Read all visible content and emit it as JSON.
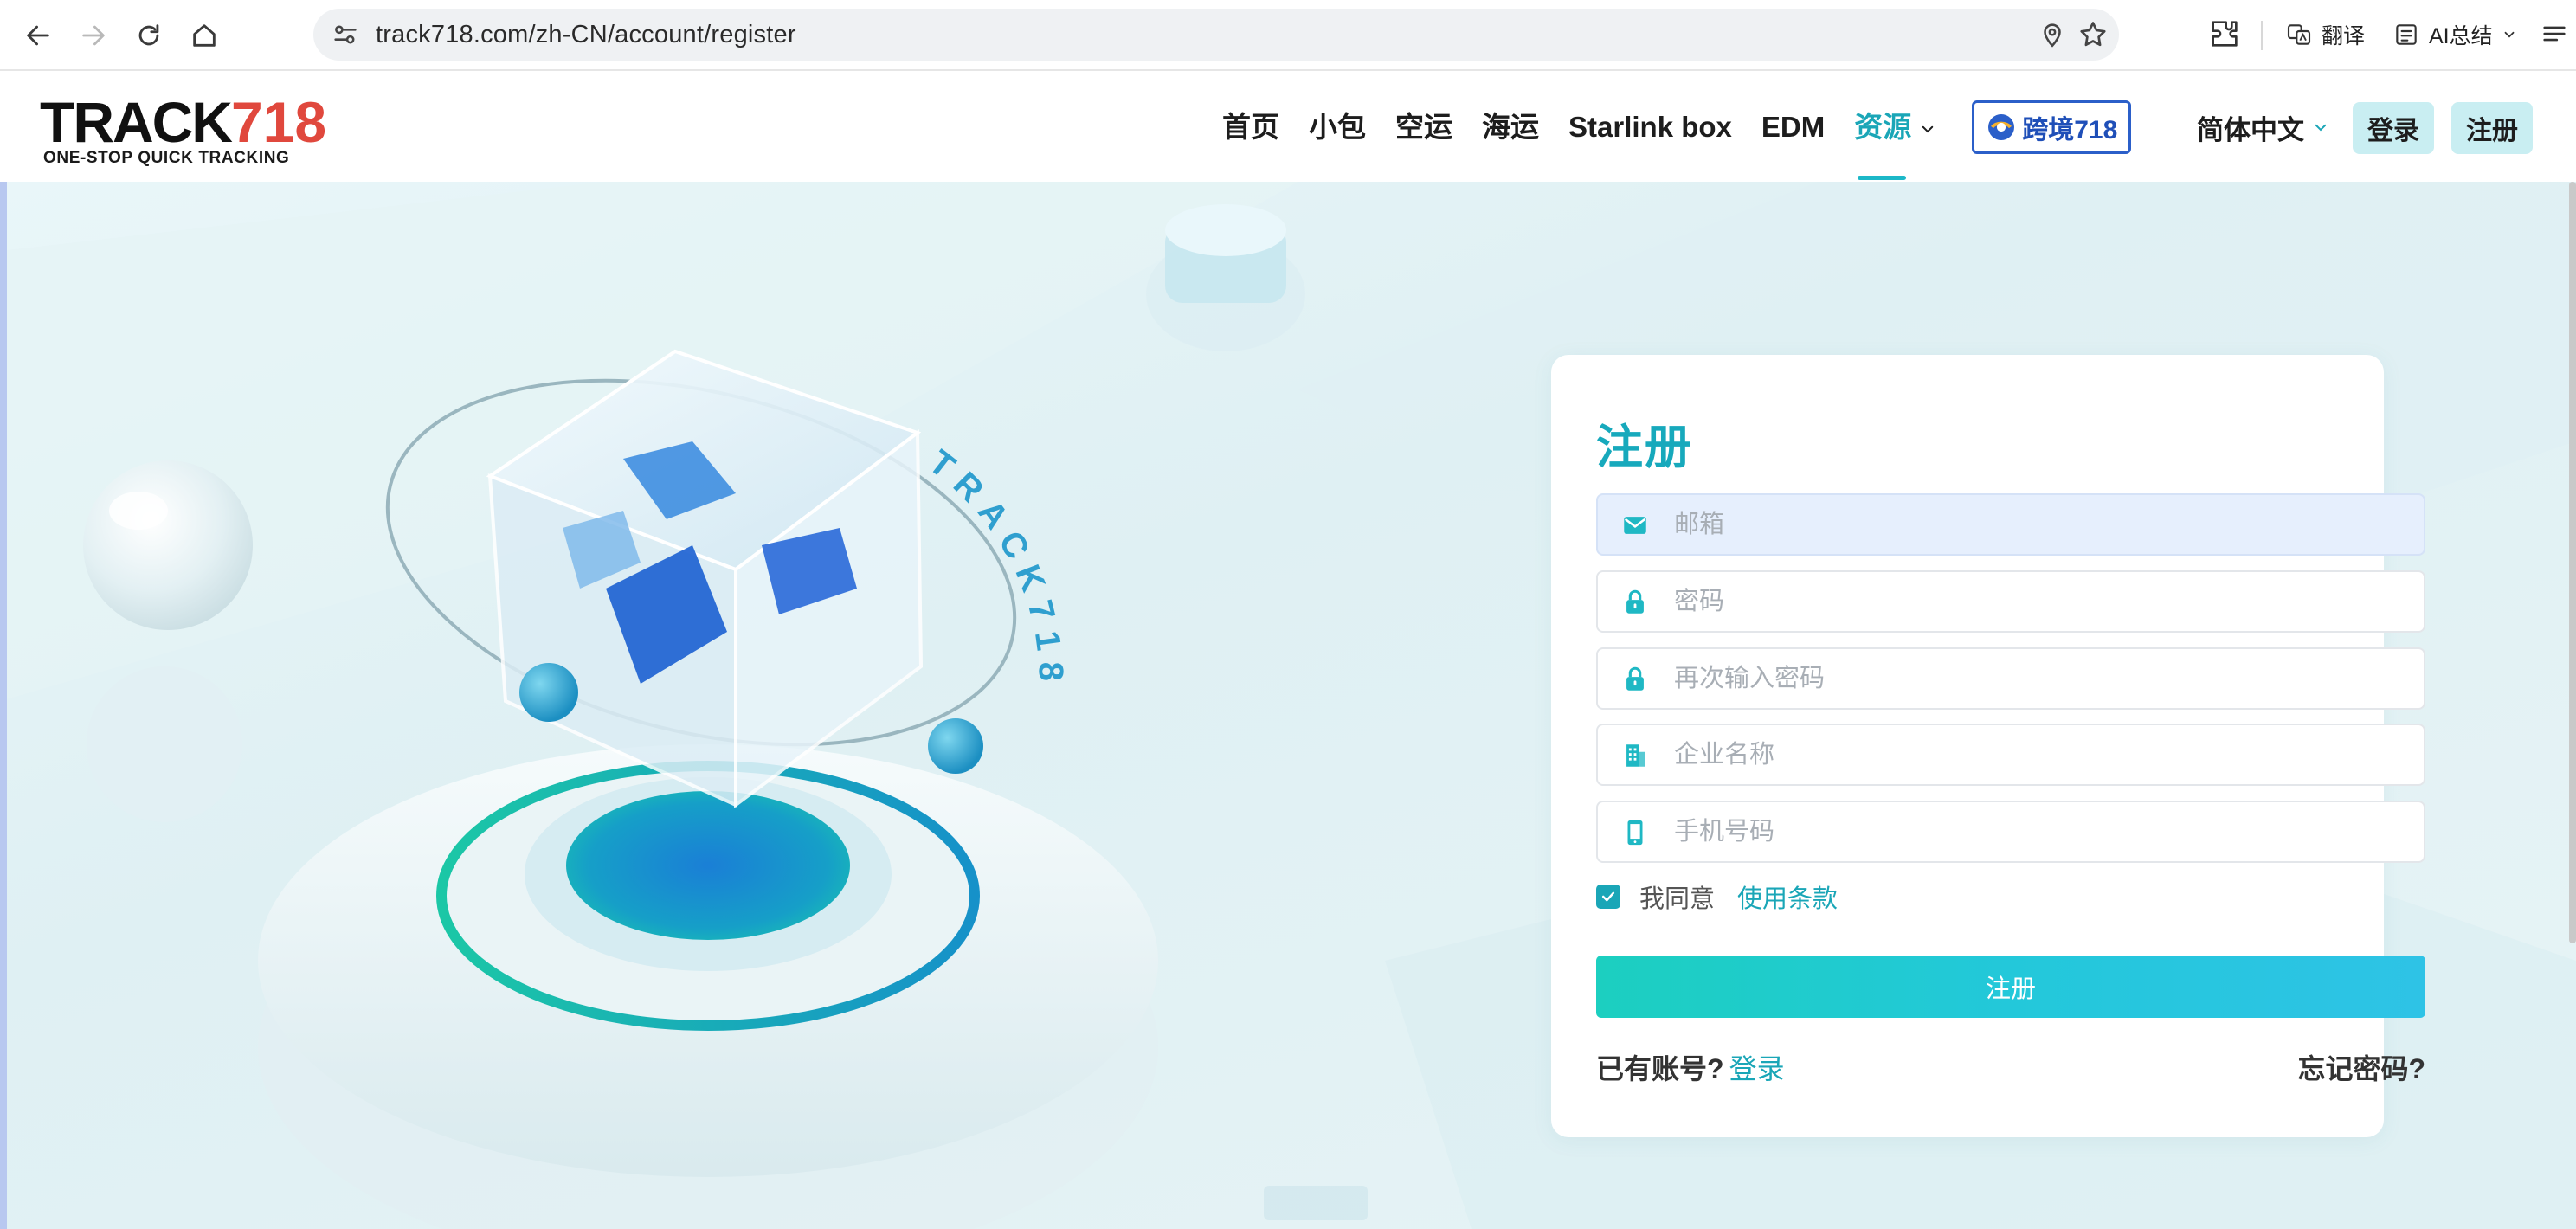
{
  "browser": {
    "url": "track718.com/zh-CN/account/register",
    "translate_label": "翻译",
    "ai_summary_label": "AI总结"
  },
  "header": {
    "logo": {
      "wordmark_prefix": "TRACK",
      "wordmark_number": "718",
      "tagline": "ONE-STOP QUICK TRACKING"
    },
    "nav": [
      {
        "label": "首页"
      },
      {
        "label": "小包"
      },
      {
        "label": "空运"
      },
      {
        "label": "海运"
      },
      {
        "label": "Starlink box"
      },
      {
        "label": "EDM"
      },
      {
        "label": "资源",
        "active": true,
        "has_dropdown": true
      }
    ],
    "partner_badge": {
      "label": "跨境718"
    },
    "language": "简体中文",
    "login_button": "登录",
    "register_button": "注册"
  },
  "hero": {
    "brand_ring_text": "TRACK718"
  },
  "register_form": {
    "title": "注册",
    "fields": [
      {
        "name": "email",
        "placeholder": "邮箱",
        "icon": "mail-icon",
        "value": ""
      },
      {
        "name": "password",
        "placeholder": "密码",
        "icon": "lock-icon",
        "value": ""
      },
      {
        "name": "password-confirm",
        "placeholder": "再次输入密码",
        "icon": "lock-icon",
        "value": ""
      },
      {
        "name": "company",
        "placeholder": "企业名称",
        "icon": "building-icon",
        "value": ""
      },
      {
        "name": "phone",
        "placeholder": "手机号码",
        "icon": "phone-icon",
        "value": ""
      }
    ],
    "agree_text": "我同意",
    "terms_link": "使用条款",
    "agree_checked": true,
    "submit_label": "注册",
    "have_account_text": "已有账号?",
    "login_link": "登录",
    "forgot_link": "忘记密码?"
  },
  "colors": {
    "accent": "#1aa6b7",
    "submit_gradient_start": "#1ccfc0",
    "submit_gradient_end": "#2ec3e6",
    "header_button_bg": "#c9eef2",
    "logo_number": "#e0483d"
  }
}
